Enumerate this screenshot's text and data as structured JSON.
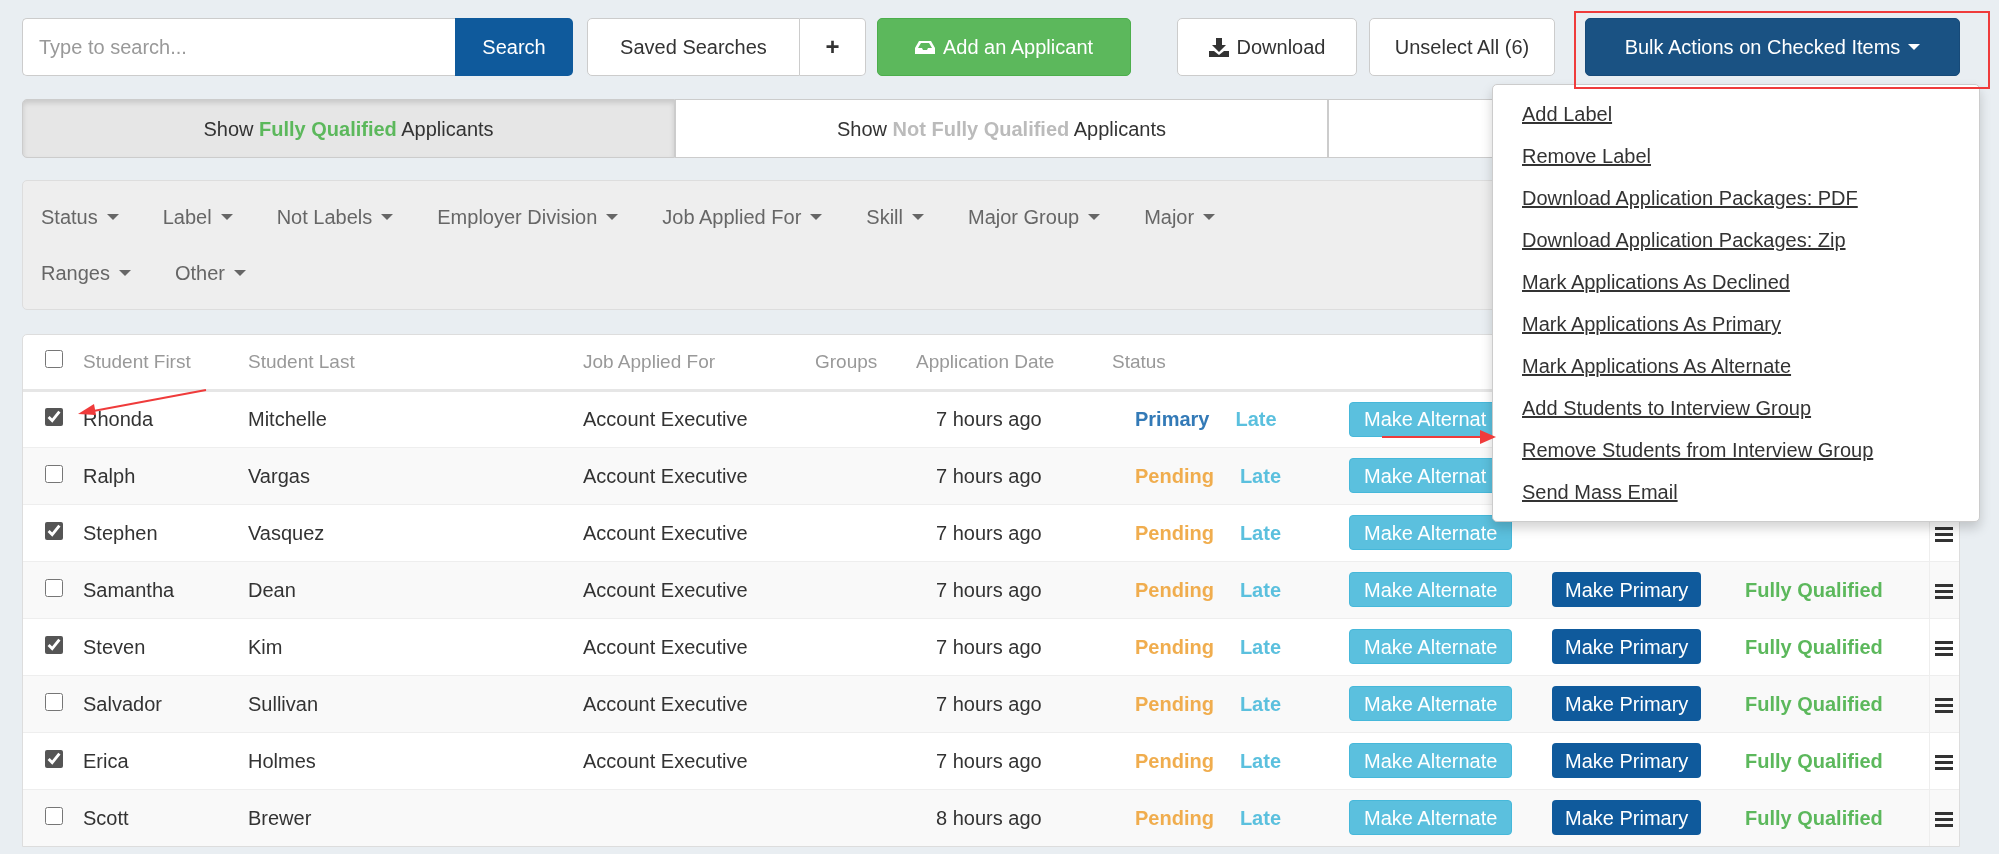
{
  "toolbar": {
    "search": {
      "placeholder": "Type to search...",
      "button": "Search"
    },
    "saved_searches": "Saved Searches",
    "add_saved": "+",
    "add_applicant": "Add an Applicant",
    "download": "Download",
    "unselect_all": "Unselect All (6)",
    "bulk_actions": {
      "label": "Bulk Actions on Checked Items",
      "expanded": true,
      "highlighted": true
    }
  },
  "toggles": [
    {
      "label": "Show **Fully Qualified** Applicants",
      "selected": true,
      "color": "#5cb85c"
    },
    {
      "label": "Show **Not Fully Qualified** Applicants",
      "selected": false,
      "color": "#bbbbbb"
    },
    {
      "selected": false
    }
  ],
  "filter_rows": [
    [
      "Status",
      "Label",
      "Not Labels",
      "Employer Division",
      "Job Applied For",
      "Skill",
      "Major Group",
      "Major"
    ],
    [
      "Ranges",
      "Other"
    ]
  ],
  "table": {
    "select_all_checked": false,
    "columns": [
      "Student First",
      "Student Last",
      "Job Applied For",
      "Groups",
      "Application Date",
      "Status"
    ],
    "rows": [
      {
        "checked": true,
        "first": "Rhonda",
        "last": "Mitchelle",
        "job": "Account Executive",
        "date": "7 hours ago",
        "status": "Primary",
        "color": "#337ab7",
        "tag": "Late",
        "make_alternate": "Make Alternat"
      },
      {
        "checked": false,
        "first": "Ralph",
        "last": "Vargas",
        "job": "Account Executive",
        "date": "7 hours ago",
        "status": "Pending",
        "color": "#f0ad4e",
        "tag": "Late",
        "make_alternate": "Make Alternat"
      },
      {
        "checked": true,
        "first": "Stephen",
        "last": "Vasquez",
        "job": "Account Executive",
        "date": "7 hours ago",
        "status": "Pending",
        "color": "#f0ad4e",
        "tag": "Late",
        "make_alternate": "Make Alternate"
      },
      {
        "checked": false,
        "first": "Samantha",
        "last": "Dean",
        "job": "Account Executive",
        "date": "7 hours ago",
        "status": "Pending",
        "color": "#f0ad4e",
        "tag": "Late",
        "make_alternate": "Make Alternate",
        "make_primary": "Make Primary",
        "qualification": "Fully Qualified"
      },
      {
        "checked": true,
        "first": "Steven",
        "last": "Kim",
        "job": "Account Executive",
        "date": "7 hours ago",
        "status": "Pending",
        "color": "#f0ad4e",
        "tag": "Late",
        "make_alternate": "Make Alternate",
        "make_primary": "Make Primary",
        "qualification": "Fully Qualified"
      },
      {
        "checked": false,
        "first": "Salvador",
        "last": "Sullivan",
        "job": "Account Executive",
        "date": "7 hours ago",
        "status": "Pending",
        "color": "#f0ad4e",
        "tag": "Late",
        "make_alternate": "Make Alternate",
        "make_primary": "Make Primary",
        "qualification": "Fully Qualified"
      },
      {
        "checked": true,
        "first": "Erica",
        "last": "Holmes",
        "job": "Account Executive",
        "date": "7 hours ago",
        "status": "Pending",
        "color": "#f0ad4e",
        "tag": "Late",
        "make_alternate": "Make Alternate",
        "make_primary": "Make Primary",
        "qualification": "Fully Qualified"
      },
      {
        "checked": false,
        "first": "Scott",
        "last": "Brewer",
        "date": "8 hours ago",
        "status": "Pending",
        "color": "#f0ad4e",
        "tag": "Late",
        "make_alternate": "Make Alternate",
        "make_primary": "Make Primary",
        "qualification": "Fully Qualified"
      }
    ]
  },
  "bulk_menu": [
    "Add Label",
    "Remove Label",
    "Download Application Packages: PDF",
    "Download Application Packages: Zip",
    "Mark Applications As Declined",
    "Mark Applications As Primary",
    "Mark Applications As Alternate",
    "Add Students to Interview Group",
    "Remove Students from Interview Group",
    "Send Mass Email"
  ]
}
